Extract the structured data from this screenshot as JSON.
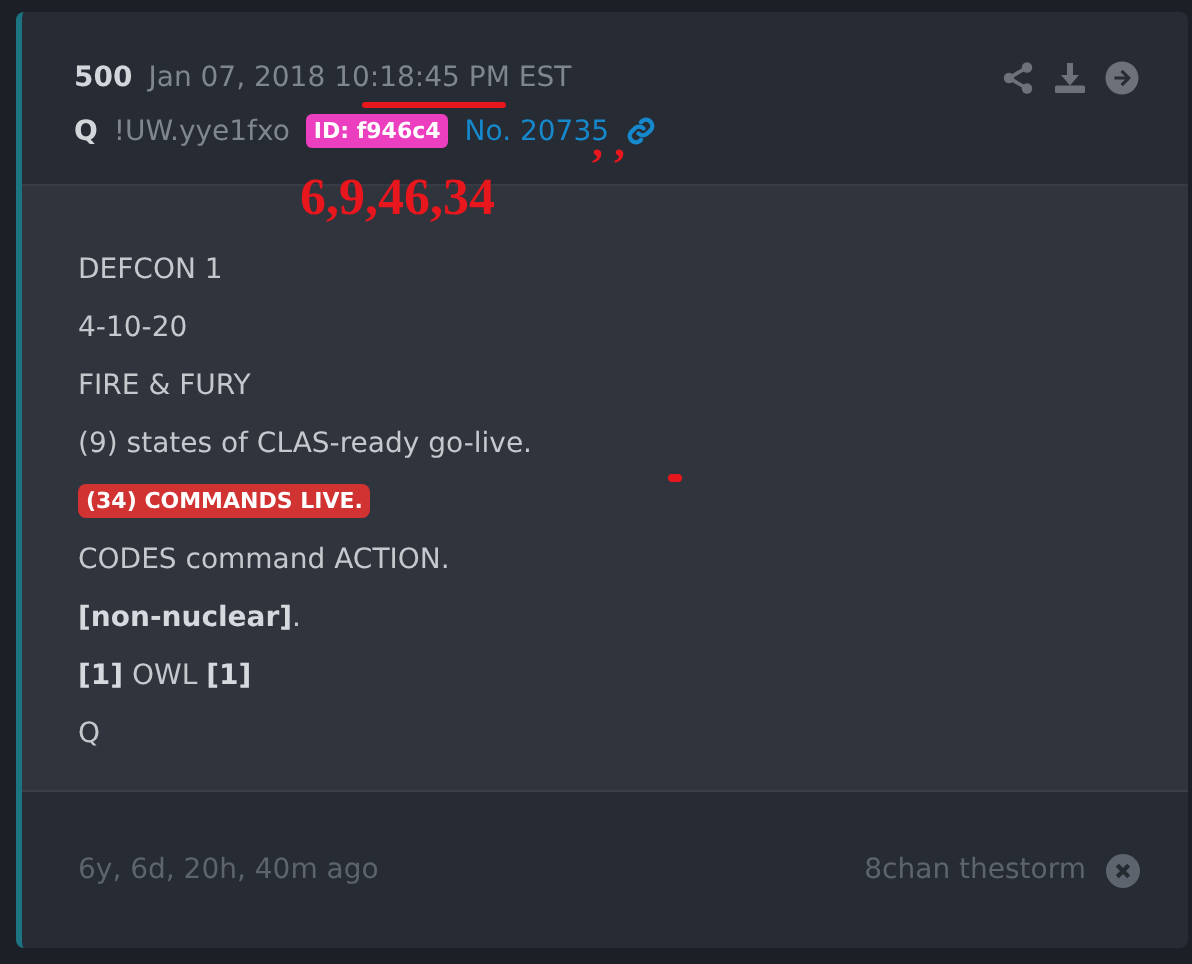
{
  "post": {
    "number": "500",
    "date": "Jan 07, 2018",
    "time": "10:18:45",
    "time_suffix": "PM EST",
    "author": "Q",
    "tripcode": "!UW.yye1fxo",
    "id_badge": "ID: f946c4",
    "post_no": "No. 20735"
  },
  "lines": [
    {
      "kind": "plain",
      "text": "DEFCON 1"
    },
    {
      "kind": "plain",
      "text": "4-10-20"
    },
    {
      "kind": "plain",
      "text": "FIRE & FURY"
    },
    {
      "kind": "plain",
      "text": "(9) states of CLAS-ready go-live."
    },
    {
      "kind": "highlight",
      "text": "(34) COMMANDS LIVE."
    },
    {
      "kind": "plain",
      "text": "CODES command ACTION."
    },
    {
      "kind": "plain",
      "text": "**[non-nuclear]**."
    },
    {
      "kind": "plain",
      "text": "**[1]** OWL **[1]**"
    },
    {
      "kind": "plain",
      "text": "Q"
    }
  ],
  "footer": {
    "age": "6y, 6d, 20h, 40m ago",
    "source": "8chan thestorm"
  },
  "annotations": [
    {
      "kind": "text",
      "text": "6,9,46,34"
    },
    {
      "kind": "text",
      "text": ", ,"
    },
    {
      "kind": "underline"
    },
    {
      "kind": "dot"
    }
  ]
}
